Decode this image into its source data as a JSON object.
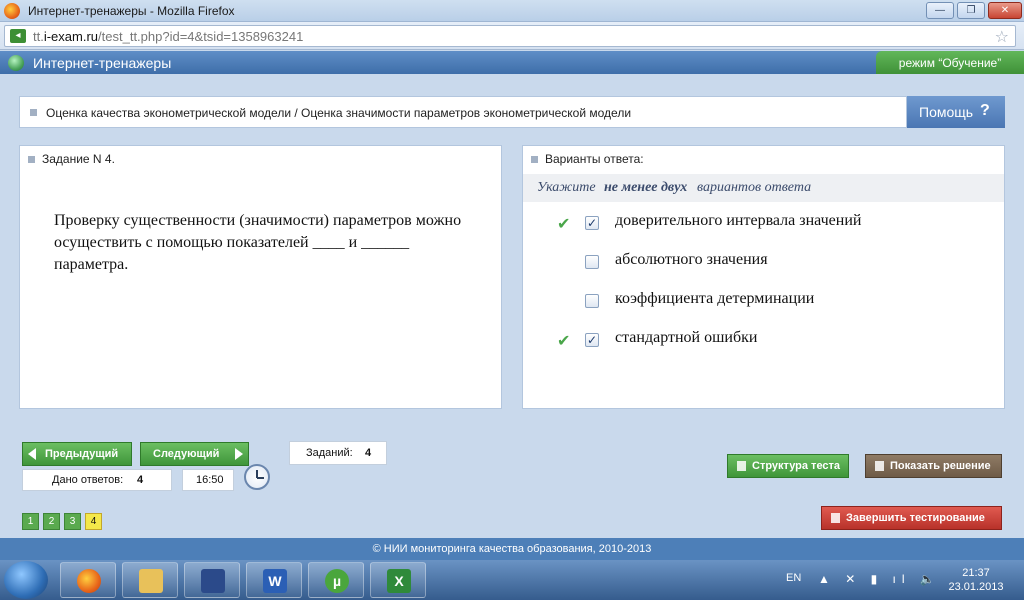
{
  "window": {
    "title": "Интернет-тренажеры - Mozilla Firefox",
    "minimize": "—",
    "maximize": "❐",
    "close": "✕"
  },
  "address": {
    "prefix": "tt.",
    "domain": "i-exam.ru",
    "path": "/test_tt.php?id=4&tsid=1358963241"
  },
  "app": {
    "title": "Интернет-тренажеры",
    "mode": "режим “Обучение”"
  },
  "topic": {
    "text": "Оценка качества эконометрической модели / Оценка значимости параметров эконометрической модели"
  },
  "help": {
    "label": "Помощь",
    "icon": "?"
  },
  "question": {
    "header": "Задание N 4.",
    "text": "Проверку существенности (значимости) параметров можно осуществить с помощью показателей ____ и ______ параметра."
  },
  "answers": {
    "header": "Варианты ответа:",
    "hint_prefix": "Укажите ",
    "hint_bold": "не менее двух",
    "hint_suffix": " вариантов ответа",
    "options": [
      {
        "label": "доверительного интервала значений",
        "checked": true,
        "mark": "✔",
        "box": "✓"
      },
      {
        "label": "абсолютного значения",
        "checked": false,
        "mark": "",
        "box": ""
      },
      {
        "label": "коэффициента детерминации",
        "checked": false,
        "mark": "",
        "box": ""
      },
      {
        "label": "стандартной ошибки",
        "checked": true,
        "mark": "✔",
        "box": "✓"
      }
    ]
  },
  "nav": {
    "prev": "Предыдущий",
    "next": "Следующий",
    "tasks_label": "Заданий:",
    "tasks_value": "4",
    "answered_label": "Дано ответов:",
    "answered_value": "4",
    "time": "16:50",
    "pages": [
      "1",
      "2",
      "3",
      "4"
    ],
    "active_page": "4"
  },
  "actions": {
    "structure": "Структура теста",
    "solution": "Показать решение",
    "finish": "Завершить тестирование"
  },
  "footer": {
    "text": "© НИИ мониторинга качества образования, 2010-2013"
  },
  "taskbar": {
    "apps": [
      {
        "icon": "firefox-icon",
        "glyph": ""
      },
      {
        "icon": "explorer-icon",
        "glyph": ""
      },
      {
        "icon": "save-icon",
        "glyph": ""
      },
      {
        "icon": "word-icon",
        "glyph": "W"
      },
      {
        "icon": "utorrent-icon",
        "glyph": "µ"
      },
      {
        "icon": "excel-icon",
        "glyph": "X"
      }
    ],
    "lang": "EN",
    "tray": "▲ ✕ ▮ ıl 🔈",
    "time": "21:37",
    "date": "23.01.2013"
  },
  "colors": {
    "accent_blue": "#4d7fb8",
    "green": "#4aa64a",
    "finish_red": "#c83a30",
    "solution_brown": "#7d6a55",
    "active_page_yellow": "#f4e84a"
  }
}
